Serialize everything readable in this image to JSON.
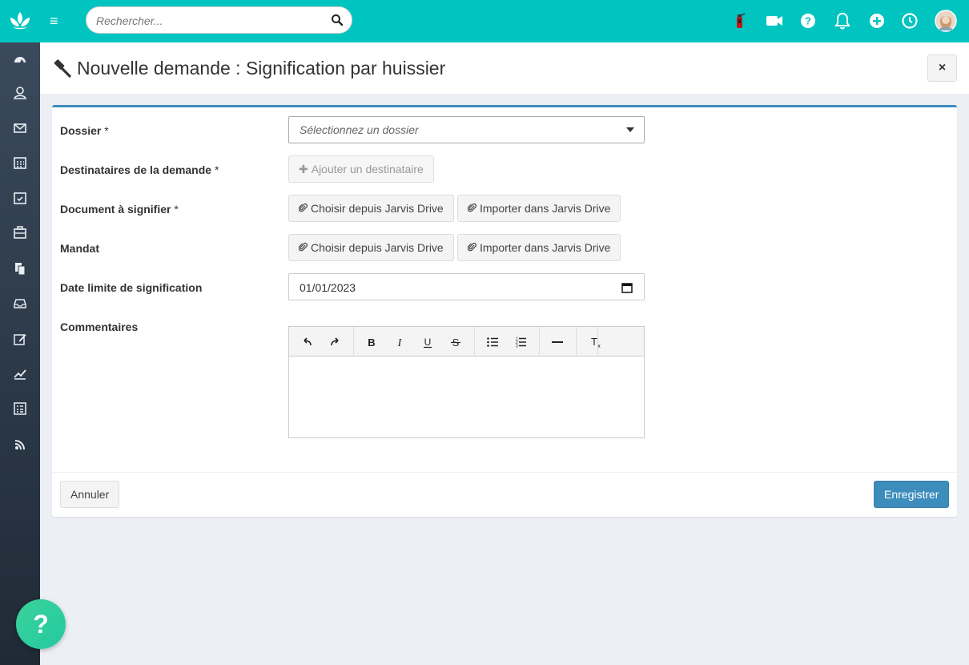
{
  "search": {
    "placeholder": "Rechercher..."
  },
  "page": {
    "title": "Nouvelle demande : Signification par huissier",
    "close_label": "×"
  },
  "form": {
    "dossier": {
      "label": "Dossier",
      "required": "*",
      "placeholder": "Sélectionnez un dossier"
    },
    "destinataires": {
      "label": "Destinataires de la demande",
      "required": "*",
      "button": "Ajouter un destinataire"
    },
    "document": {
      "label": "Document à signifier",
      "required": "*",
      "choose": "Choisir depuis Jarvis Drive",
      "import": "Importer dans Jarvis Drive"
    },
    "mandat": {
      "label": "Mandat",
      "choose": "Choisir depuis Jarvis Drive",
      "import": "Importer dans Jarvis Drive"
    },
    "date_limite": {
      "label": "Date limite de signification",
      "value": "01/01/2023"
    },
    "commentaires": {
      "label": "Commentaires"
    }
  },
  "footer": {
    "cancel": "Annuler",
    "save": "Enregistrer"
  },
  "help": {
    "label": "?"
  },
  "colors": {
    "topbar": "#00c4c0",
    "primary": "#3c8dbc",
    "sidebar": "#2c3a48",
    "help_fab": "#2ecf9c"
  }
}
